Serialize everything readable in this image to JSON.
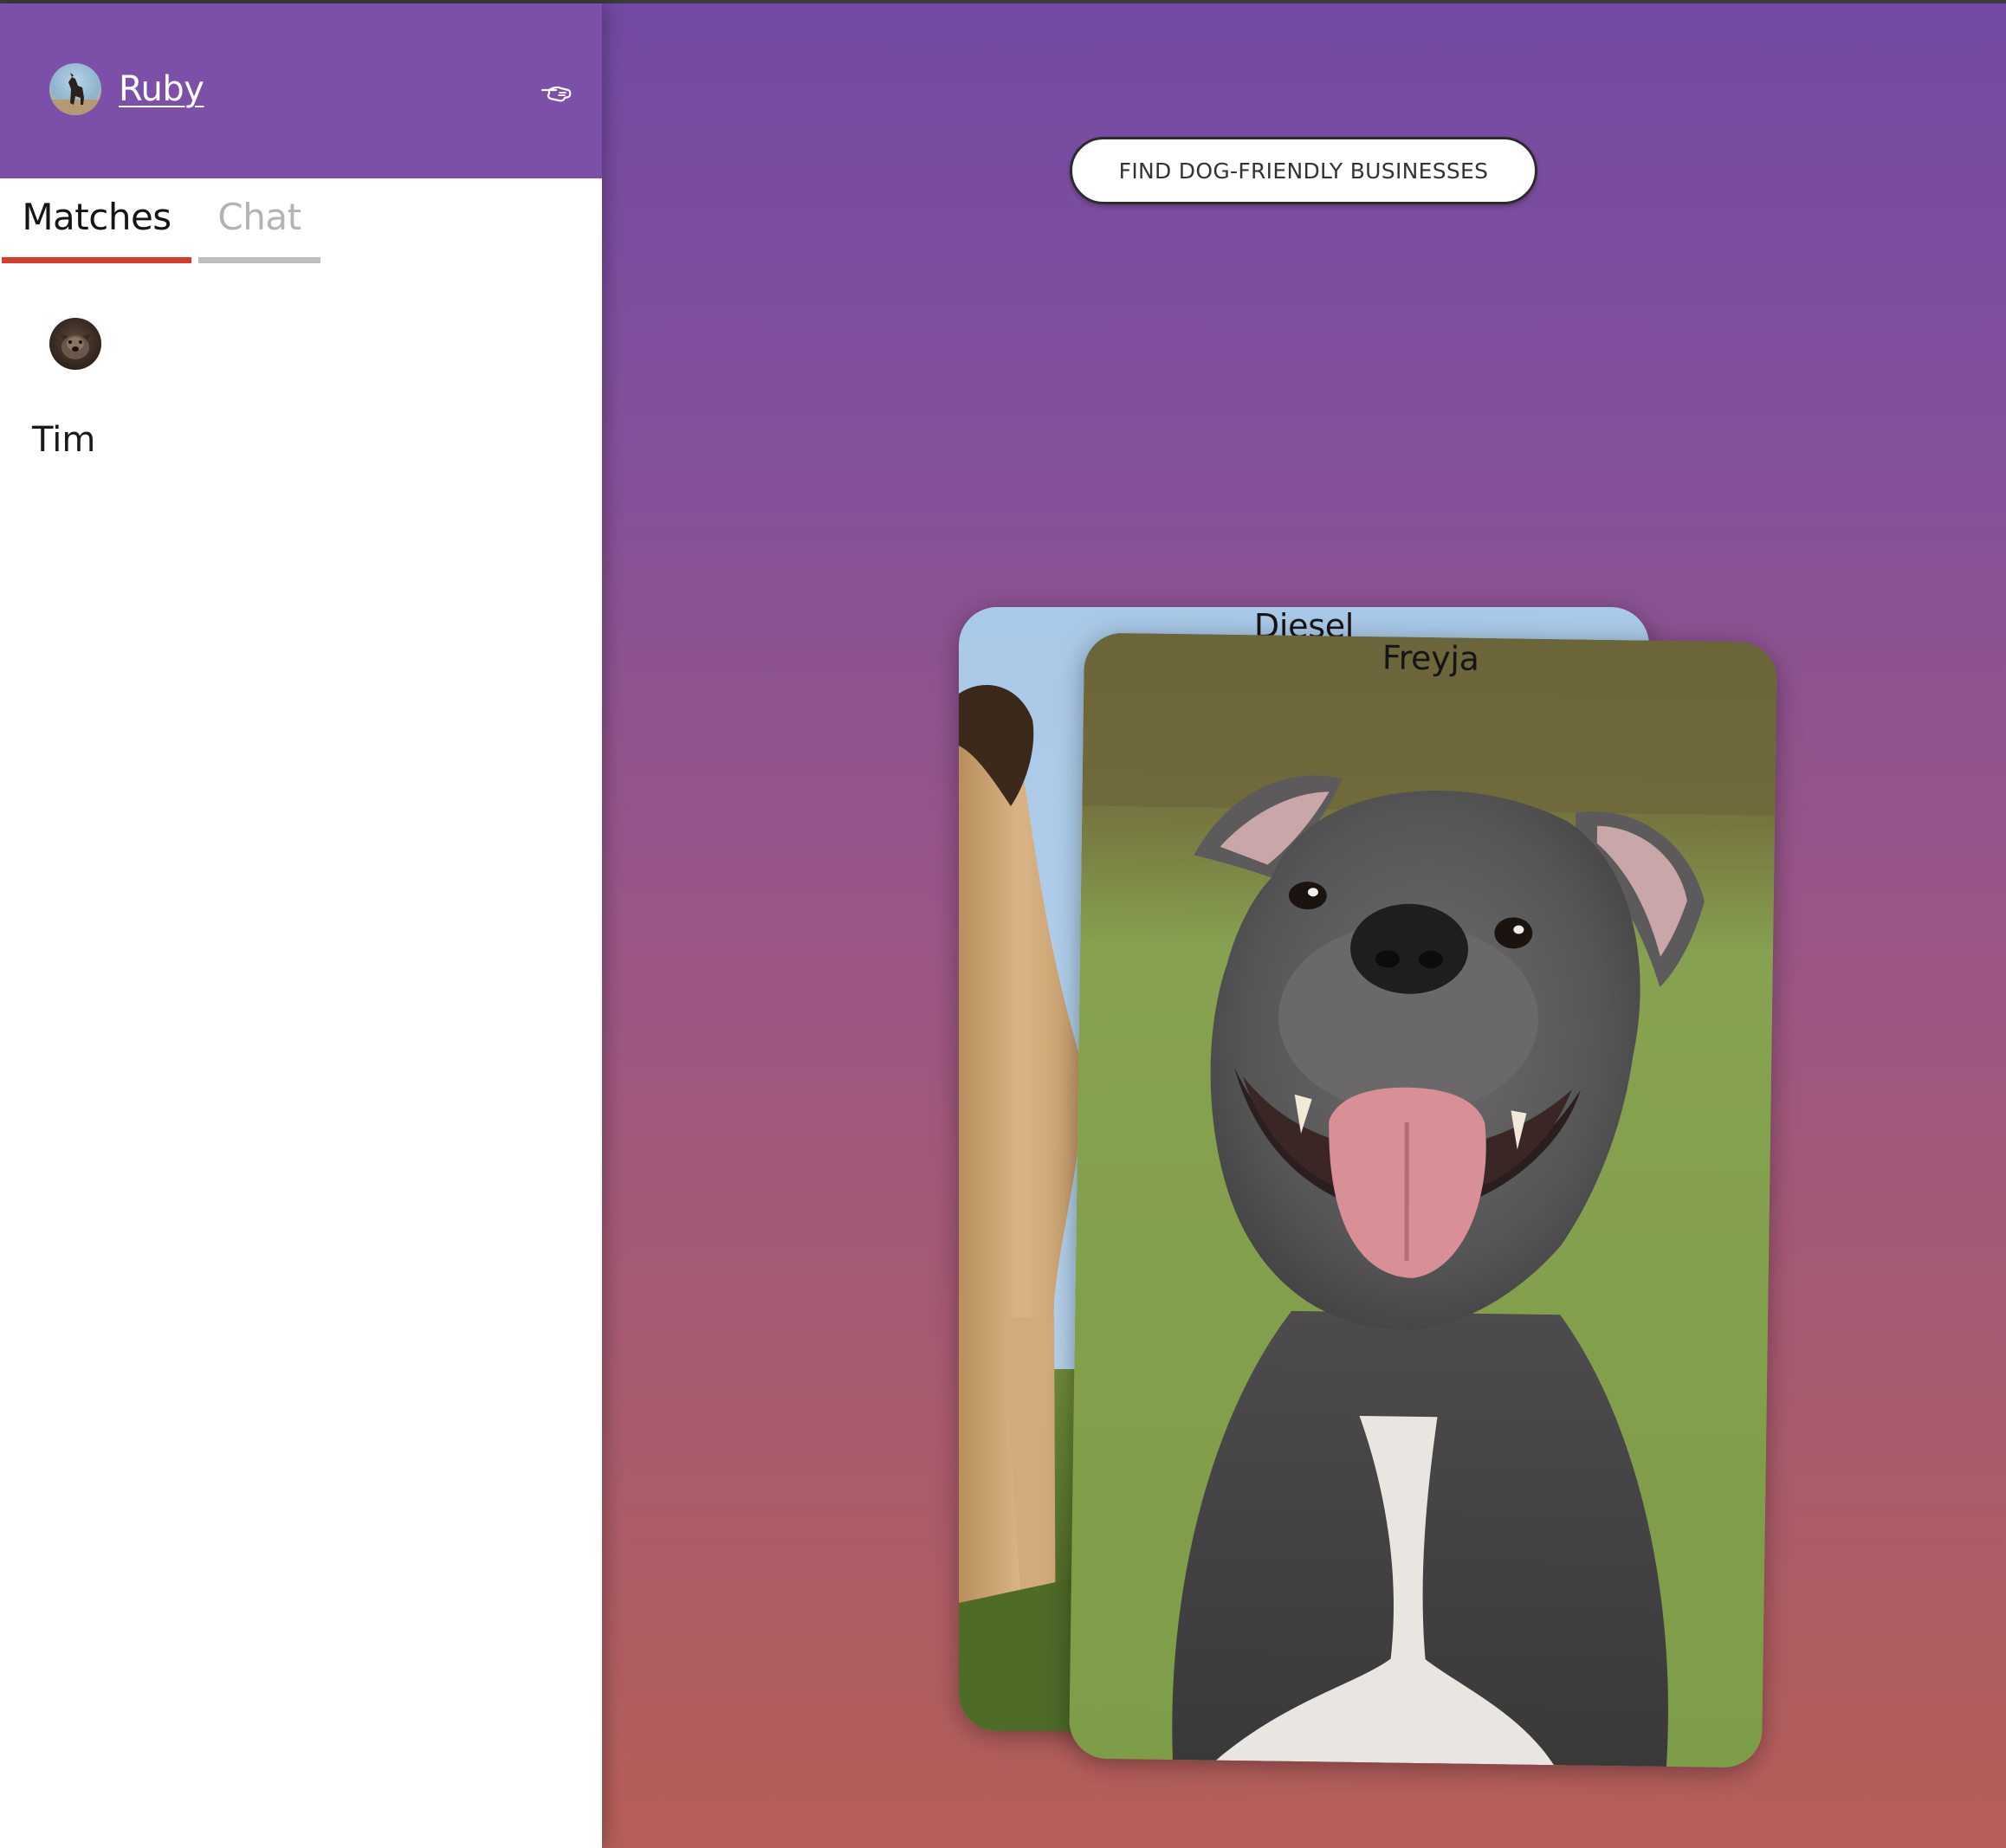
{
  "sidebar": {
    "user": {
      "name": "Ruby",
      "avatar_icon": "dog-avatar",
      "logout_icon": "pointing-hand-icon"
    },
    "tabs": [
      {
        "label": "Matches",
        "active": true
      },
      {
        "label": "Chat",
        "active": false
      }
    ],
    "matches": [
      {
        "name": "Tim",
        "avatar_icon": "dog-avatar"
      }
    ]
  },
  "main": {
    "find_button_label": "FIND DOG-FRIENDLY BUSINESSES",
    "cards": [
      {
        "name": "Diesel",
        "photo": "tan-mastiff-dog-photo"
      },
      {
        "name": "Freyja",
        "photo": "grey-pitbull-dog-photo"
      }
    ]
  },
  "colors": {
    "header_purple": "#7c50a9",
    "gradient_top": "#724aa4",
    "gradient_bottom": "#b65f58",
    "active_tab_underline": "#d93a2b",
    "inactive_tab_underline": "#bdbdbd"
  }
}
